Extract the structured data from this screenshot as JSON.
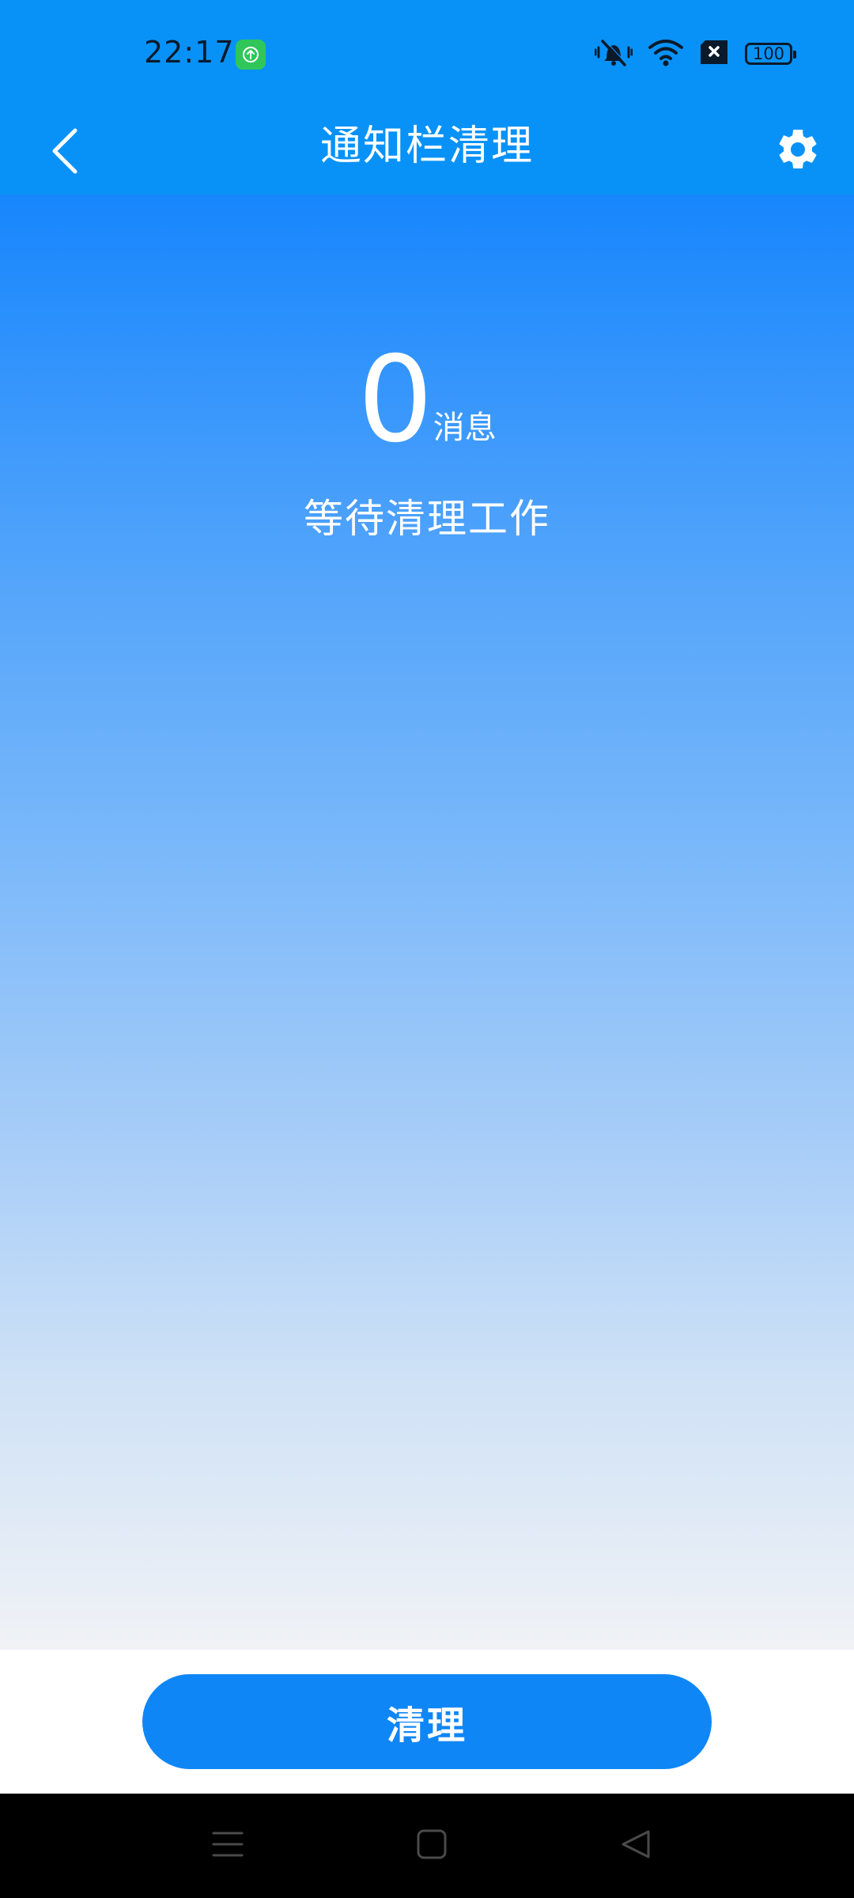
{
  "status_bar": {
    "time": "22:17",
    "app_icon": "upload-arrow-icon",
    "icons": [
      "vibrate-mute-icon",
      "wifi-icon",
      "no-sim-icon",
      "battery-icon"
    ],
    "battery_level": "100"
  },
  "header": {
    "back_icon": "chevron-left-icon",
    "title": "通知栏清理",
    "settings_icon": "gear-icon"
  },
  "summary": {
    "count": "0",
    "unit": "消息",
    "status": "等待清理工作"
  },
  "actions": {
    "clean_label": "清理"
  },
  "nav_bar": {
    "icons": [
      "menu-icon",
      "home-icon",
      "back-triangle-icon"
    ]
  },
  "colors": {
    "accent": "#0892f7",
    "button": "#0f86f6",
    "gradient_top": "#1786fd",
    "gradient_bottom": "#f0f2f6"
  }
}
